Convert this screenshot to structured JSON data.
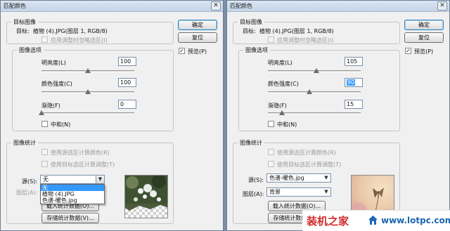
{
  "dialogs": [
    {
      "title": "匹配颜色",
      "target_group": {
        "legend": "目标图像",
        "target_label": "目标:",
        "target_value": "植物 (4).JPG(图层 1, RGB/8)",
        "apply_selection_label": "应用调整时忽略选区(I)"
      },
      "options_group": {
        "legend": "图像选项",
        "luminance_label": "明亮度(L)",
        "luminance_value": "100",
        "color_intensity_label": "颜色强度(C)",
        "color_intensity_value": "100",
        "fade_label": "渐隐(F)",
        "fade_value": "0",
        "neutralize_label": "中和(N)",
        "luminance_level": 0.5,
        "color_intensity_level": 0.5,
        "fade_level": 0.0
      },
      "stats_group": {
        "legend": "图像统计",
        "use_source_selection_label": "使用源选区计算颜色(R)",
        "use_target_selection_label": "使用目标选区计算调整(T)",
        "source_label": "源(S):",
        "source_value": "无",
        "layer_label": "图层(A):",
        "load_button": "载入统计数据(O)...",
        "save_button": "存储统计数据(V)...",
        "dropdown_options": [
          "无",
          "植物 (4).JPG",
          "色谱-暖色.jpg"
        ]
      },
      "buttons": {
        "ok": "确定",
        "reset": "复位",
        "preview_label": "预览(P)"
      }
    },
    {
      "title": "匹配颜色",
      "target_group": {
        "legend": "目标图像",
        "target_label": "目标:",
        "target_value": "植物 (4).JPG(图层 1, RGB/8)",
        "apply_selection_label": "应用调整时忽略选区(I)"
      },
      "options_group": {
        "legend": "图像选项",
        "luminance_label": "明亮度(L)",
        "luminance_value": "105",
        "color_intensity_label": "颜色强度(C)",
        "color_intensity_value": "90",
        "fade_label": "渐隐(F)",
        "fade_value": "15",
        "neutralize_label": "中和(N)",
        "luminance_level": 0.525,
        "color_intensity_level": 0.45,
        "fade_level": 0.15
      },
      "stats_group": {
        "legend": "图像统计",
        "use_source_selection_label": "使用源选区计算颜色(R)",
        "use_target_selection_label": "使用目标选区计算调整(T)",
        "source_label": "源(S):",
        "source_value": "色谱-暖色.jpg",
        "layer_label": "图层(A):",
        "layer_value": "背景",
        "load_button": "载入统计数据(O)...",
        "save_button": "存储统计数据(V)..."
      },
      "buttons": {
        "ok": "确定",
        "reset": "复位",
        "preview_label": "预览(P)"
      }
    }
  ],
  "watermark": {
    "brand": "装机之家",
    "url": "www.lotpc.com"
  },
  "colors": {
    "selection": "#3399ff",
    "titlebar": "#c4d4e7",
    "watermark_red": "#d12b2b",
    "watermark_blue": "#1b67b3"
  }
}
